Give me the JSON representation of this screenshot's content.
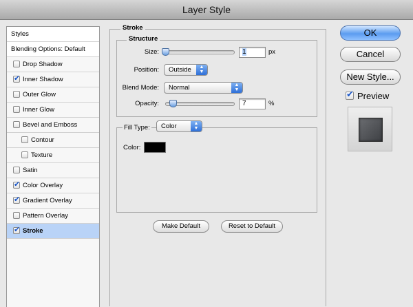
{
  "window": {
    "title": "Layer Style"
  },
  "sidebar": {
    "items": [
      {
        "label": "Styles",
        "type": "header"
      },
      {
        "label": "Blending Options: Default",
        "type": "header"
      },
      {
        "label": "Drop Shadow",
        "checked": false
      },
      {
        "label": "Inner Shadow",
        "checked": true
      },
      {
        "label": "Outer Glow",
        "checked": false
      },
      {
        "label": "Inner Glow",
        "checked": false
      },
      {
        "label": "Bevel and Emboss",
        "checked": false
      },
      {
        "label": "Contour",
        "checked": false,
        "indent": true
      },
      {
        "label": "Texture",
        "checked": false,
        "indent": true
      },
      {
        "label": "Satin",
        "checked": false
      },
      {
        "label": "Color Overlay",
        "checked": true
      },
      {
        "label": "Gradient Overlay",
        "checked": true
      },
      {
        "label": "Pattern Overlay",
        "checked": false
      },
      {
        "label": "Stroke",
        "checked": true,
        "selected": true
      }
    ]
  },
  "stroke": {
    "title": "Stroke",
    "structure": {
      "title": "Structure",
      "size_label": "Size:",
      "size_value": "1",
      "size_unit": "px",
      "position_label": "Position:",
      "position_value": "Outside",
      "blend_mode_label": "Blend Mode:",
      "blend_mode_value": "Normal",
      "opacity_label": "Opacity:",
      "opacity_value": "7",
      "opacity_unit": "%"
    },
    "fill": {
      "fill_type_label": "Fill Type:",
      "fill_type_value": "Color",
      "color_label": "Color:",
      "color_value": "#000000"
    },
    "make_default_label": "Make Default",
    "reset_default_label": "Reset to Default"
  },
  "buttons": {
    "ok": "OK",
    "cancel": "Cancel",
    "new_style": "New Style...",
    "preview_label": "Preview",
    "preview_checked": true
  },
  "colors": {
    "selected_row": "#b9d3f7",
    "checkmark": "#1c58c9",
    "primary_button": "#5b9cf0"
  }
}
